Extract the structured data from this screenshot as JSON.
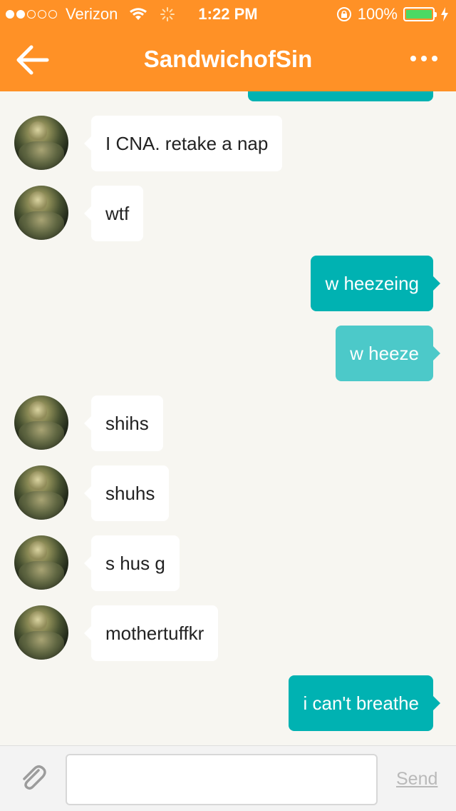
{
  "status_bar": {
    "carrier": "Verizon",
    "time": "1:22 PM",
    "battery": "100%",
    "signal_dots_filled": 2,
    "signal_dots_total": 5
  },
  "header": {
    "title": "SandwichofSin",
    "background_color": "#ff9126"
  },
  "messages": [
    {
      "direction": "in",
      "text": "I CNA. retake a nap"
    },
    {
      "direction": "in",
      "text": "wtf"
    },
    {
      "direction": "out",
      "text": "w heezeing"
    },
    {
      "direction": "out",
      "text": "w heeze",
      "state": "pending"
    },
    {
      "direction": "in",
      "text": "shihs"
    },
    {
      "direction": "in",
      "text": "shuhs"
    },
    {
      "direction": "in",
      "text": "s hus g"
    },
    {
      "direction": "in",
      "text": "mothertuffkr"
    },
    {
      "direction": "out",
      "text": "i can't breathe"
    }
  ],
  "composer": {
    "value": "",
    "send_label": "Send"
  },
  "colors": {
    "outgoing_bubble": "#00b2b2",
    "incoming_bubble": "#ffffff",
    "chat_background": "#f7f6f1"
  }
}
